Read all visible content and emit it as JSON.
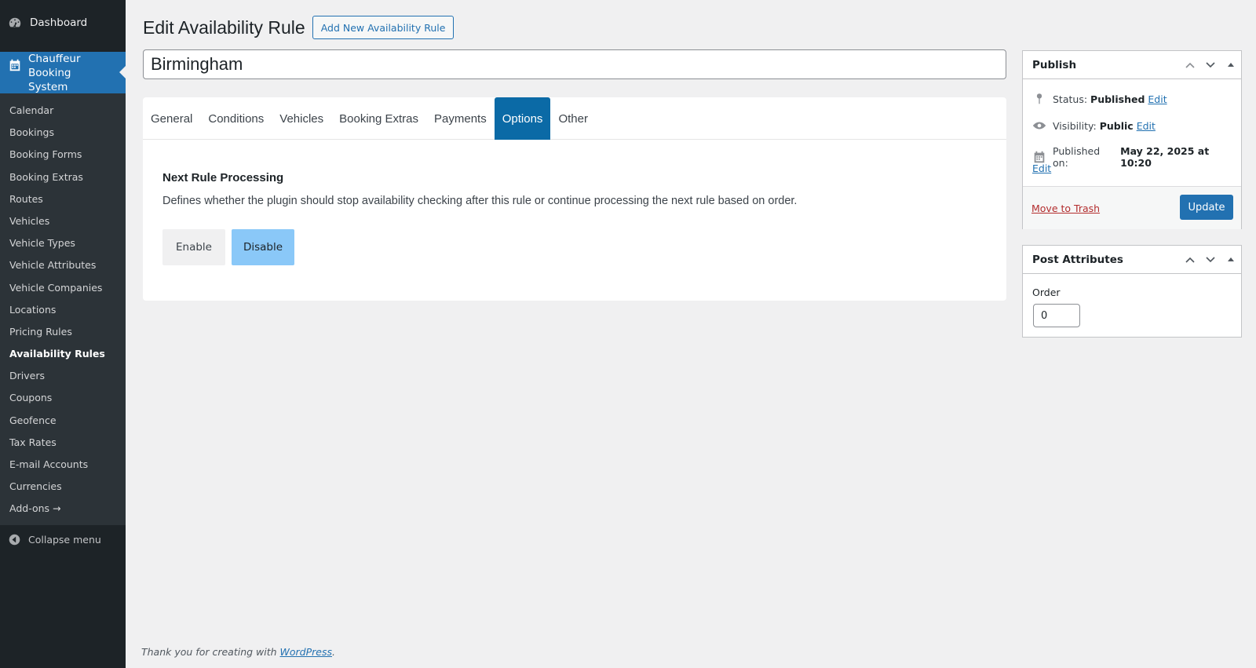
{
  "sidebar": {
    "dashboard_label": "Dashboard",
    "current_menu_label": "Chauffeur Booking System",
    "items": [
      {
        "label": "Calendar"
      },
      {
        "label": "Bookings"
      },
      {
        "label": "Booking Forms"
      },
      {
        "label": "Booking Extras"
      },
      {
        "label": "Routes"
      },
      {
        "label": "Vehicles"
      },
      {
        "label": "Vehicle Types"
      },
      {
        "label": "Vehicle Attributes"
      },
      {
        "label": "Vehicle Companies"
      },
      {
        "label": "Locations"
      },
      {
        "label": "Pricing Rules"
      },
      {
        "label": "Availability Rules"
      },
      {
        "label": "Drivers"
      },
      {
        "label": "Coupons"
      },
      {
        "label": "Geofence"
      },
      {
        "label": "Tax Rates"
      },
      {
        "label": "E-mail Accounts"
      },
      {
        "label": "Currencies"
      },
      {
        "label": "Add-ons →"
      }
    ],
    "active_item": "Availability Rules",
    "collapse_label": "Collapse menu"
  },
  "header": {
    "title": "Edit Availability Rule",
    "add_new_label": "Add New Availability Rule"
  },
  "post_title": "Birmingham",
  "tabs": [
    {
      "label": "General"
    },
    {
      "label": "Conditions"
    },
    {
      "label": "Vehicles"
    },
    {
      "label": "Booking Extras"
    },
    {
      "label": "Payments"
    },
    {
      "label": "Options"
    },
    {
      "label": "Other"
    }
  ],
  "active_tab": "Options",
  "options_panel": {
    "heading": "Next Rule Processing",
    "description": "Defines whether the plugin should stop availability checking after this rule or continue processing the next rule based on order.",
    "enable_label": "Enable",
    "disable_label": "Disable",
    "selected": "Disable"
  },
  "publish_box": {
    "title": "Publish",
    "status_label": "Status:",
    "status_value": "Published",
    "visibility_label": "Visibility:",
    "visibility_value": "Public",
    "published_label": "Published on:",
    "published_value": "May 22, 2025 at 10:20",
    "edit_label": "Edit",
    "trash_label": "Move to Trash",
    "update_label": "Update"
  },
  "attributes_box": {
    "title": "Post Attributes",
    "order_label": "Order",
    "order_value": "0"
  },
  "footer": {
    "text": "Thank you for creating with",
    "link": "WordPress",
    "suffix": "."
  },
  "colors": {
    "sidebar_bg": "#1d2327",
    "submenu_bg": "#2c3338",
    "accent": "#2271b1",
    "active_tab": "#0b6aa6",
    "selected_toggle": "#8ac8f8",
    "trash": "#b32d2e"
  }
}
